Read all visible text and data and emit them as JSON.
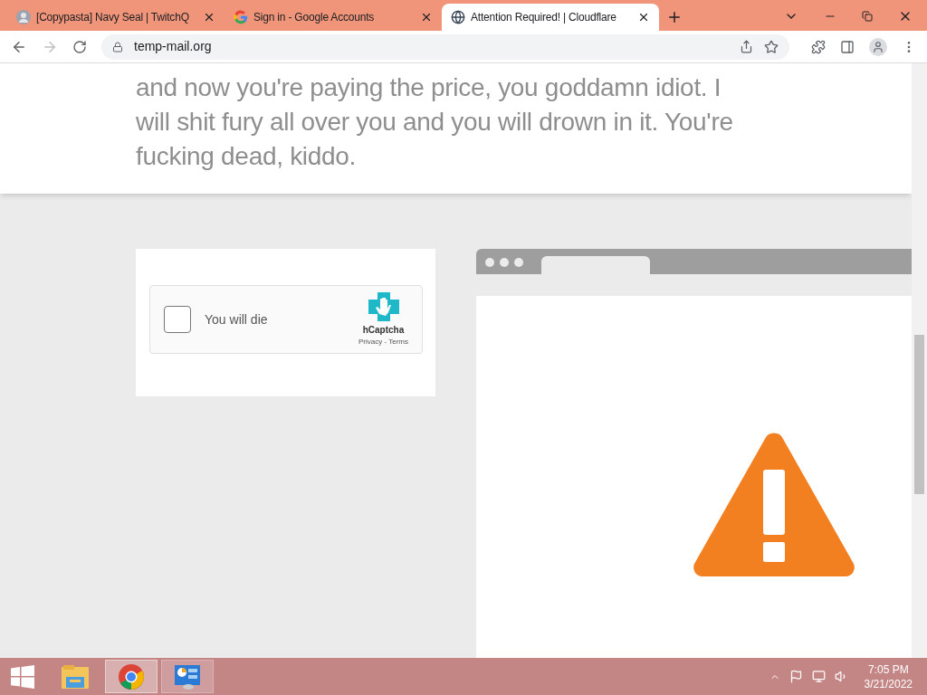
{
  "tabs": [
    {
      "title": "[Copypasta] Navy Seal | TwitchQ",
      "selected": false,
      "kind": "avatar"
    },
    {
      "title": "Sign in - Google Accounts",
      "selected": false,
      "kind": "google"
    },
    {
      "title": "Attention Required! | Cloudflare",
      "selected": true,
      "kind": "globe"
    }
  ],
  "address_bar": {
    "url": "temp-mail.org"
  },
  "quote": {
    "lines": [
      "and now you're paying the price, you goddamn idiot. I",
      "will shit fury all over you and you will drown in it. You're",
      "fucking dead, kiddo."
    ]
  },
  "captcha": {
    "label": "You will die",
    "checked": false,
    "brand": "hCaptcha",
    "links": [
      "Privacy",
      "Terms"
    ],
    "separator": " - "
  },
  "taskbar": {
    "apps": [
      {
        "kind": "explorer",
        "selected": false
      },
      {
        "kind": "chrome",
        "selected": true
      },
      {
        "kind": "control",
        "selected": false
      }
    ],
    "time": "7:05 PM",
    "date": "3/21/2022"
  }
}
